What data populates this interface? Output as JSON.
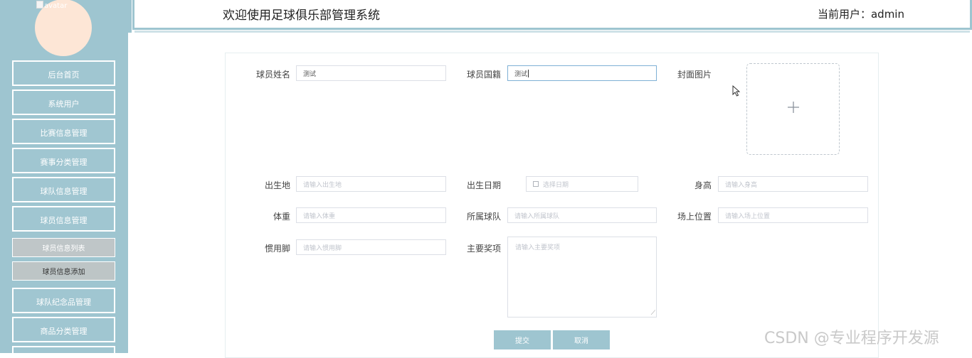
{
  "sidebar": {
    "avatar_alt": "avatar",
    "items": [
      {
        "label": "后台首页"
      },
      {
        "label": "系统用户"
      },
      {
        "label": "比赛信息管理"
      },
      {
        "label": "赛事分类管理"
      },
      {
        "label": "球队信息管理"
      },
      {
        "label": "球员信息管理"
      },
      {
        "label": "球队纪念品管理"
      },
      {
        "label": "商品分类管理"
      }
    ],
    "sub_items": [
      {
        "label": "球员信息列表"
      },
      {
        "label": "球员信息添加"
      }
    ]
  },
  "header": {
    "title": "欢迎使用足球俱乐部管理系统",
    "user": "当前用户：admin"
  },
  "form": {
    "name": {
      "label": "球员姓名",
      "value": "测试"
    },
    "nationality": {
      "label": "球员国籍",
      "value": "测试"
    },
    "cover": {
      "label": "封面图片"
    },
    "birthplace": {
      "label": "出生地",
      "placeholder": "请输入出生地"
    },
    "birthdate": {
      "label": "出生日期",
      "placeholder": "选择日期"
    },
    "height": {
      "label": "身高",
      "placeholder": "请输入身高"
    },
    "weight": {
      "label": "体重",
      "placeholder": "请输入体重"
    },
    "team": {
      "label": "所属球队",
      "placeholder": "请输入所属球队"
    },
    "position": {
      "label": "场上位置",
      "placeholder": "请输入场上位置"
    },
    "foot": {
      "label": "惯用脚",
      "placeholder": "请输入惯用脚"
    },
    "awards": {
      "label": "主要奖项",
      "placeholder": "请输入主要奖项"
    },
    "submit_label": "提交",
    "cancel_label": "取消"
  },
  "watermark": "CSDN @专业程序开发源"
}
